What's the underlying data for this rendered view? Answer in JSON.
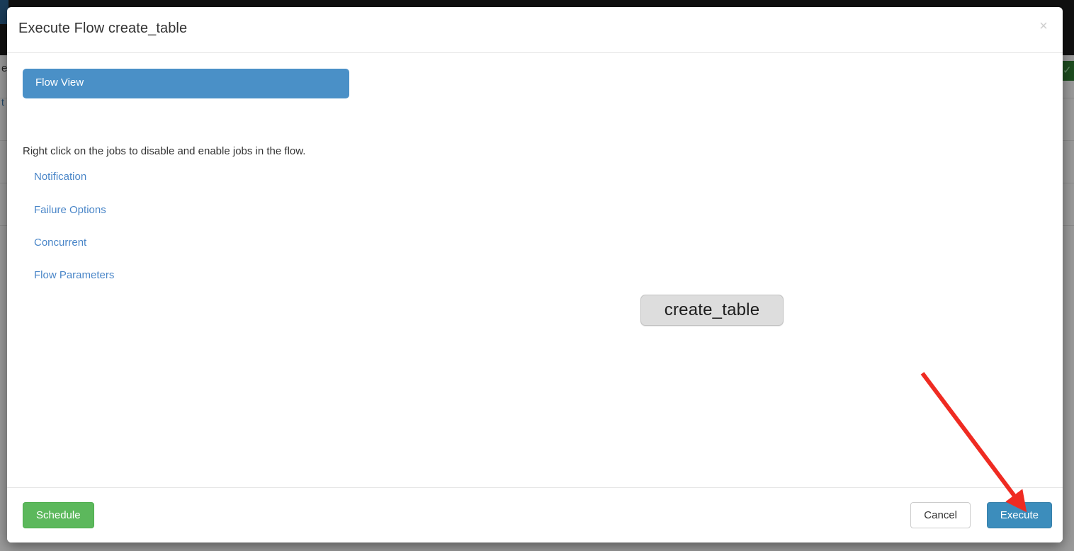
{
  "modal": {
    "title": "Execute Flow create_table",
    "close_icon": "close-icon",
    "close_label": "×"
  },
  "options_panel": {
    "active_tab": "Flow View",
    "hint": "Right click on the jobs to disable and enable jobs in the flow.",
    "links": [
      {
        "label": "Notification"
      },
      {
        "label": "Failure Options"
      },
      {
        "label": "Concurrent"
      },
      {
        "label": "Flow Parameters"
      }
    ]
  },
  "flow_graph": {
    "nodes": [
      {
        "label": "create_table"
      }
    ]
  },
  "footer": {
    "schedule_label": "Schedule",
    "cancel_label": "Cancel",
    "execute_label": "Execute"
  },
  "annotation": {
    "type": "arrow",
    "color": "#ef2b22",
    "points_to": "Execute"
  },
  "background_page": {
    "fragments": [
      {
        "text": "e"
      },
      {
        "text": "t"
      }
    ]
  },
  "colors": {
    "tab_blue": "#4a90c7",
    "link_blue": "#4a86c8",
    "execute_blue": "#3c8dbc",
    "schedule_green": "#5cb85c",
    "node_gray": "#dddddd",
    "arrow_red": "#ef2b22"
  }
}
